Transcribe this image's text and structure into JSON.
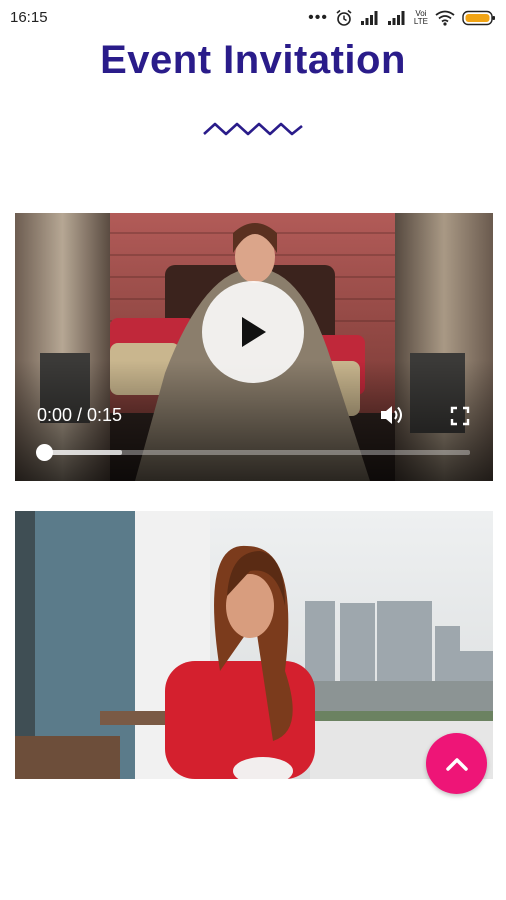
{
  "status_bar": {
    "time": "16:15",
    "volte_top": "Voi",
    "volte_bottom": "LTE"
  },
  "header": {
    "title": "Event Invitation"
  },
  "video": {
    "time_display": "0:00 / 0:15",
    "progress": 0.18,
    "icons": [
      "play-icon",
      "volume-icon",
      "fullscreen-icon"
    ]
  },
  "scroll_top_button": {
    "icon": "chevron-up-icon",
    "color": "#ee1577"
  },
  "colors": {
    "title": "#2a1c8a",
    "fab": "#ee1577"
  }
}
